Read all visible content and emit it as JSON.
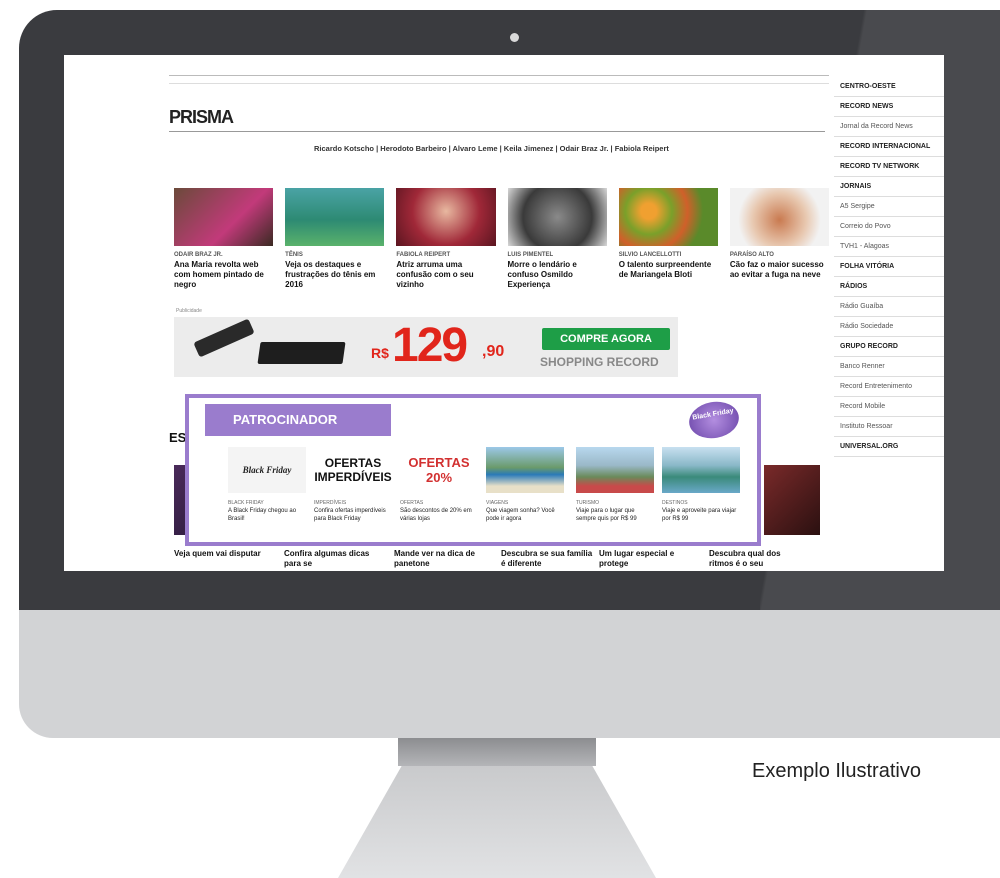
{
  "caption": "Exemplo Ilustrativo",
  "site": {
    "logo": "PRISMA",
    "authors": "Ricardo Kotscho | Herodoto Barbeiro | Alvaro Leme | Keila Jimenez | Odair Braz Jr. | Fabiola Reipert",
    "articles": [
      {
        "category": "ODAIR BRAZ JR.",
        "title": "Ana Maria revolta web com homem pintado de negro",
        "icon": "woman-photo"
      },
      {
        "category": "TÊNIS",
        "title": "Veja os destaques e frustrações do tênis em 2016",
        "icon": "tennis-photo"
      },
      {
        "category": "FABIOLA REIPERT",
        "title": "Atriz arruma uma confusão com o seu vizinho",
        "icon": "actress-photo"
      },
      {
        "category": "LUIS PIMENTEL",
        "title": "Morre o lendário e confuso Osmildo Experiença",
        "icon": "man-photo"
      },
      {
        "category": "SILVIO LANCELLOTTI",
        "title": "O talento surpreendente de Mariangela Bloti",
        "icon": "food-photo"
      },
      {
        "category": "PARAÍSO ALTO",
        "title": "Cão faz o maior sucesso ao evitar a fuga na neve",
        "icon": "dog-photo"
      }
    ],
    "ad_label": "Publicidade",
    "banner": {
      "currency": "R$",
      "price": "129",
      "cents": ",90",
      "button": "COMPRE AGORA",
      "store": "SHOPPING RECORD"
    },
    "section_title": "ESPEC",
    "bottom_articles": [
      {
        "title": "Veja quem vai disputar"
      },
      {
        "title": "Confira algumas dicas para se"
      },
      {
        "title": "Mande ver na dica de panetone"
      },
      {
        "title": "Descubra se sua família é diferente"
      },
      {
        "title": "Um lugar especial e protege"
      },
      {
        "title": "Descubra qual dos ritmos é o seu"
      }
    ]
  },
  "sidebar": [
    {
      "label": "CENTRO-OESTE",
      "kind": "h"
    },
    {
      "label": "RECORD NEWS",
      "kind": "h"
    },
    {
      "label": "Jornal da Record News",
      "kind": "s"
    },
    {
      "label": "RECORD INTERNACIONAL",
      "kind": "h"
    },
    {
      "label": "RECORD TV NETWORK",
      "kind": "h"
    },
    {
      "label": "JORNAIS",
      "kind": "h"
    },
    {
      "label": "A5 Sergipe",
      "kind": "s"
    },
    {
      "label": "Correio do Povo",
      "kind": "s"
    },
    {
      "label": "TVH1 - Alagoas",
      "kind": "s"
    },
    {
      "label": "FOLHA VITÓRIA",
      "kind": "h"
    },
    {
      "label": "RÁDIOS",
      "kind": "h"
    },
    {
      "label": "Rádio Guaíba",
      "kind": "s"
    },
    {
      "label": "Rádio Sociedade",
      "kind": "s"
    },
    {
      "label": "GRUPO RECORD",
      "kind": "h"
    },
    {
      "label": "Banco Renner",
      "kind": "s"
    },
    {
      "label": "Record Entretenimento",
      "kind": "s"
    },
    {
      "label": "Record Mobile",
      "kind": "s"
    },
    {
      "label": "Instituto Ressoar",
      "kind": "s"
    },
    {
      "label": "UNIVERSAL.ORG",
      "kind": "h"
    }
  ],
  "sponsor": {
    "tag": "PATROCINADOR",
    "logo_text": "Black Friday",
    "cards": [
      {
        "category": "Black Friday",
        "title": "A Black Friday chegou ao Brasil!",
        "ad_text": "Black Friday"
      },
      {
        "category": "Imperdíveis",
        "title": "Confira ofertas imperdíveis para Black Friday",
        "ad_text": "OFERTAS IMPERDÍVEIS"
      },
      {
        "category": "Ofertas",
        "title": "São descontos de 20% em várias lojas",
        "ad_text": "OFERTAS 20%"
      },
      {
        "category": "Viagens",
        "title": "Que viagem sonha? Você pode ir agora",
        "ad_text": ""
      },
      {
        "category": "Turismo",
        "title": "Viaje para o lugar que sempre quis por R$ 99",
        "ad_text": ""
      },
      {
        "category": "Destinos",
        "title": "Viaje e aproveite para viajar por R$ 99",
        "ad_text": ""
      }
    ]
  },
  "colors": {
    "accent": "#9a7ccd",
    "price": "#e1251b",
    "buy": "#1e9e47",
    "bezel": "#3a3b3f"
  }
}
